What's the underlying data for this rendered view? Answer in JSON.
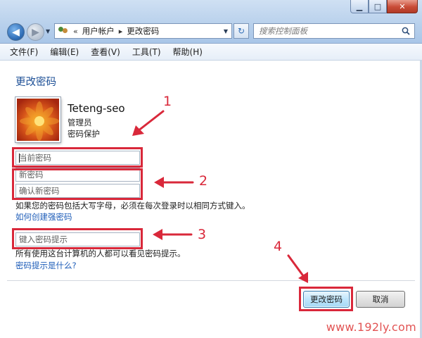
{
  "window": {
    "buttons": {
      "minimize": "▁",
      "maximize": "□",
      "close": "✕"
    }
  },
  "nav": {
    "back": "◀",
    "forward": "▶",
    "dropdown": "▼"
  },
  "address": {
    "icon": "users-icon",
    "prefix": "«",
    "crumbs": [
      "用户帐户",
      "更改密码"
    ],
    "separator": "▸",
    "dropdown": "▼"
  },
  "refresh_glyph": "↻",
  "search": {
    "placeholder": "搜索控制面板",
    "icon": "search-icon"
  },
  "menu": [
    "文件(F)",
    "编辑(E)",
    "查看(V)",
    "工具(T)",
    "帮助(H)"
  ],
  "page": {
    "title": "更改密码",
    "user": {
      "name": "Teteng-seo",
      "role": "管理员",
      "status": "密码保护"
    },
    "fields": {
      "current_password": "当前密码",
      "new_password": "新密码",
      "confirm_password": "确认新密码",
      "password_hint": "键入密码提示"
    },
    "info_text": "如果您的密码包括大写字母，必须在每次登录时以相同方式键入。",
    "link_strong_password": "如何创建强密码",
    "hint_note": "所有使用这台计算机的人都可以看见密码提示。",
    "link_hint": "密码提示是什么?"
  },
  "annotations": [
    "1",
    "2",
    "3",
    "4"
  ],
  "buttons": {
    "change_password": "更改密码",
    "cancel": "取消"
  },
  "watermark": "www.192ly.com",
  "colors": {
    "annotation_red": "#d9283a",
    "title_blue": "#1c4f96",
    "link_blue": "#1d5cb8"
  }
}
